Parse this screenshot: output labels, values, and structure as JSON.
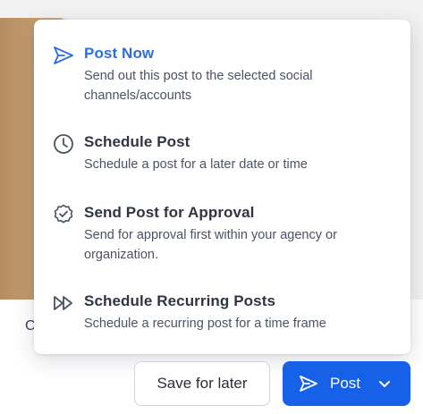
{
  "menu": {
    "items": [
      {
        "title": "Post Now",
        "description": "Send out this post to the selected social channels/accounts",
        "icon": "send-icon",
        "active": true
      },
      {
        "title": "Schedule Post",
        "description": "Schedule a post for a later date or time",
        "icon": "clock-icon",
        "active": false
      },
      {
        "title": "Send Post for Approval",
        "description": "Send for approval first within your agency or organization.",
        "icon": "badge-check-icon",
        "active": false
      },
      {
        "title": "Schedule Recurring Posts",
        "description": "Schedule a recurring post for a time frame",
        "icon": "fast-forward-icon",
        "active": false
      }
    ]
  },
  "background": {
    "peek_text": "C"
  },
  "footer": {
    "save_label": "Save for later",
    "post_label": "Post"
  },
  "colors": {
    "accent": "#2d6de0",
    "primary_button": "#1760e8",
    "text": "#2f3542"
  }
}
